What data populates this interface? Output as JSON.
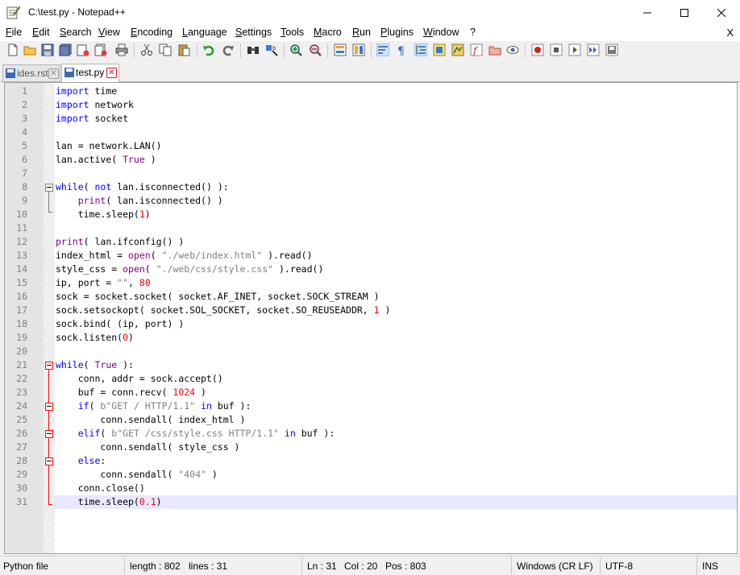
{
  "window": {
    "title": "C:\\test.py - Notepad++",
    "icon": "notepad-icon"
  },
  "menu": {
    "items": [
      "File",
      "Edit",
      "Search",
      "View",
      "Encoding",
      "Language",
      "Settings",
      "Tools",
      "Macro",
      "Run",
      "Plugins",
      "Window",
      "?"
    ],
    "close_doc": "X"
  },
  "tabs": [
    {
      "label": "ides.rst",
      "active": false
    },
    {
      "label": "test.py",
      "active": true
    }
  ],
  "editor": {
    "current_line": 31,
    "lines": [
      [
        {
          "t": "kw",
          "v": "import"
        },
        {
          "t": "",
          "v": " time"
        }
      ],
      [
        {
          "t": "kw",
          "v": "import"
        },
        {
          "t": "",
          "v": " network"
        }
      ],
      [
        {
          "t": "kw",
          "v": "import"
        },
        {
          "t": "",
          "v": " socket"
        }
      ],
      [],
      [
        {
          "t": "",
          "v": "lan = network.LAN()"
        }
      ],
      [
        {
          "t": "",
          "v": "lan.active( "
        },
        {
          "t": "bi",
          "v": "True"
        },
        {
          "t": "",
          "v": " )"
        }
      ],
      [],
      [
        {
          "t": "kw",
          "v": "while"
        },
        {
          "t": "",
          "v": "( "
        },
        {
          "t": "kw",
          "v": "not"
        },
        {
          "t": "",
          "v": " lan.isconnected() ):"
        }
      ],
      [
        {
          "t": "",
          "v": "    "
        },
        {
          "t": "bi",
          "v": "print"
        },
        {
          "t": "",
          "v": "( lan.isconnected() )"
        }
      ],
      [
        {
          "t": "",
          "v": "    time.sleep("
        },
        {
          "t": "num",
          "v": "1"
        },
        {
          "t": "",
          "v": ")"
        }
      ],
      [],
      [
        {
          "t": "bi",
          "v": "print"
        },
        {
          "t": "",
          "v": "( lan.ifconfig() )"
        }
      ],
      [
        {
          "t": "",
          "v": "index_html = "
        },
        {
          "t": "bi",
          "v": "open"
        },
        {
          "t": "",
          "v": "( "
        },
        {
          "t": "str",
          "v": "\"./web/index.html\""
        },
        {
          "t": "",
          "v": " ).read()"
        }
      ],
      [
        {
          "t": "",
          "v": "style_css = "
        },
        {
          "t": "bi",
          "v": "open"
        },
        {
          "t": "",
          "v": "( "
        },
        {
          "t": "str",
          "v": "\"./web/css/style.css\""
        },
        {
          "t": "",
          "v": " ).read()"
        }
      ],
      [
        {
          "t": "",
          "v": "ip, port = "
        },
        {
          "t": "str",
          "v": "\"\""
        },
        {
          "t": "",
          "v": ", "
        },
        {
          "t": "num",
          "v": "80"
        }
      ],
      [
        {
          "t": "",
          "v": "sock = socket.socket( socket.AF_INET, socket.SOCK_STREAM )"
        }
      ],
      [
        {
          "t": "",
          "v": "sock.setsockopt( socket.SOL_SOCKET, socket.SO_REUSEADDR, "
        },
        {
          "t": "num",
          "v": "1"
        },
        {
          "t": "",
          "v": " )"
        }
      ],
      [
        {
          "t": "",
          "v": "sock.bind( (ip, port) )"
        }
      ],
      [
        {
          "t": "",
          "v": "sock.listen("
        },
        {
          "t": "num",
          "v": "0"
        },
        {
          "t": "",
          "v": ")"
        }
      ],
      [],
      [
        {
          "t": "kw",
          "v": "while"
        },
        {
          "t": "",
          "v": "( "
        },
        {
          "t": "bi",
          "v": "True"
        },
        {
          "t": "",
          "v": " ):"
        }
      ],
      [
        {
          "t": "",
          "v": "    conn, addr = sock.accept()"
        }
      ],
      [
        {
          "t": "",
          "v": "    buf = conn.recv( "
        },
        {
          "t": "num",
          "v": "1024"
        },
        {
          "t": "",
          "v": " )"
        }
      ],
      [
        {
          "t": "",
          "v": "    "
        },
        {
          "t": "kw",
          "v": "if"
        },
        {
          "t": "",
          "v": "( "
        },
        {
          "t": "str",
          "v": "b\"GET / HTTP/1.1\""
        },
        {
          "t": "",
          "v": " "
        },
        {
          "t": "kw",
          "v": "in"
        },
        {
          "t": "",
          "v": " buf ):"
        }
      ],
      [
        {
          "t": "",
          "v": "        conn.sendall( index_html )"
        }
      ],
      [
        {
          "t": "",
          "v": "    "
        },
        {
          "t": "kw",
          "v": "elif"
        },
        {
          "t": "",
          "v": "( "
        },
        {
          "t": "str",
          "v": "b\"GET /css/style.css HTTP/1.1\""
        },
        {
          "t": "",
          "v": " "
        },
        {
          "t": "kw",
          "v": "in"
        },
        {
          "t": "",
          "v": " buf ):"
        }
      ],
      [
        {
          "t": "",
          "v": "        conn.sendall( style_css )"
        }
      ],
      [
        {
          "t": "",
          "v": "    "
        },
        {
          "t": "kw",
          "v": "else"
        },
        {
          "t": "",
          "v": ":"
        }
      ],
      [
        {
          "t": "",
          "v": "        conn.sendall( "
        },
        {
          "t": "str",
          "v": "\"404\""
        },
        {
          "t": "",
          "v": " )"
        }
      ],
      [
        {
          "t": "",
          "v": "    conn.close()"
        }
      ],
      [
        {
          "t": "",
          "v": "    time.sleep("
        },
        {
          "t": "num",
          "v": "0.1"
        },
        {
          "t": "",
          "v": ")"
        }
      ]
    ]
  },
  "status": {
    "filetype": "Python file",
    "length": "length : 802",
    "lines": "lines : 31",
    "ln": "Ln : 31",
    "col": "Col : 20",
    "pos": "Pos : 803",
    "eol": "Windows (CR LF)",
    "encoding": "UTF-8",
    "mode": "INS"
  }
}
